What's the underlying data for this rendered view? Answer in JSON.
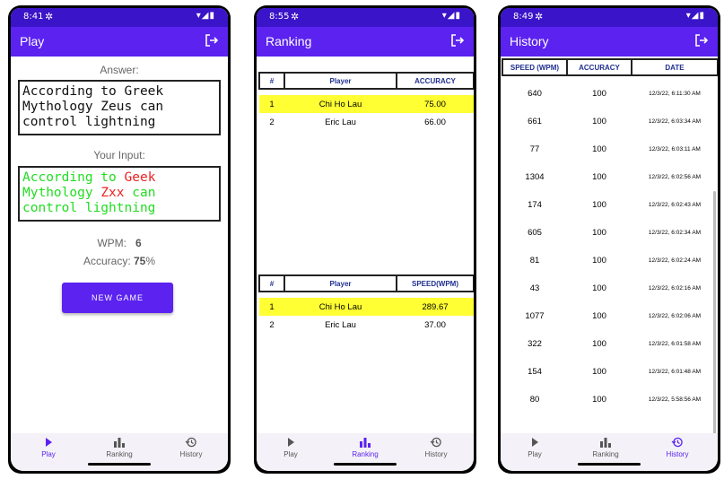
{
  "nav": {
    "play": "Play",
    "ranking": "Ranking",
    "history": "History"
  },
  "play_screen": {
    "status_time": "8:41",
    "title": "Play",
    "answer_label": "Answer:",
    "answer_text": "According to Greek Mythology Zeus can control lightning",
    "input_label": "Your Input:",
    "input_segments": [
      {
        "text": "According to ",
        "correct": true
      },
      {
        "text": "Geek",
        "correct": false
      },
      {
        "text": " Mythology ",
        "correct": true
      },
      {
        "text": "Zxx",
        "correct": false
      },
      {
        "text": " can control lightning",
        "correct": true
      }
    ],
    "wpm_label": "WPM:",
    "wpm_value": "6",
    "accuracy_label": "Accuracy:",
    "accuracy_value": "75",
    "accuracy_unit": "%",
    "new_game": "NEW GAME"
  },
  "ranking_screen": {
    "status_time": "8:55",
    "title": "Ranking",
    "accuracy_table": {
      "headers": [
        "#",
        "Player",
        "ACCURACY"
      ],
      "rows": [
        {
          "rank": "1",
          "player": "Chi Ho Lau",
          "value": "75.00",
          "highlight": true
        },
        {
          "rank": "2",
          "player": "Eric Lau",
          "value": "66.00",
          "highlight": false
        }
      ]
    },
    "speed_table": {
      "headers": [
        "#",
        "Player",
        "SPEED(WPM)"
      ],
      "rows": [
        {
          "rank": "1",
          "player": "Chi Ho Lau",
          "value": "289.67",
          "highlight": true
        },
        {
          "rank": "2",
          "player": "Eric Lau",
          "value": "37.00",
          "highlight": false
        }
      ]
    }
  },
  "history_screen": {
    "status_time": "8:49",
    "title": "History",
    "headers": [
      "SPEED (WPM)",
      "ACCURACY",
      "DATE"
    ],
    "rows": [
      {
        "speed": "640",
        "accuracy": "100",
        "date": "12/3/22, 6:11:30 AM"
      },
      {
        "speed": "661",
        "accuracy": "100",
        "date": "12/3/22, 6:03:34 AM"
      },
      {
        "speed": "77",
        "accuracy": "100",
        "date": "12/3/22, 6:03:11 AM"
      },
      {
        "speed": "1304",
        "accuracy": "100",
        "date": "12/3/22, 6:02:56 AM"
      },
      {
        "speed": "174",
        "accuracy": "100",
        "date": "12/3/22, 6:02:43 AM"
      },
      {
        "speed": "605",
        "accuracy": "100",
        "date": "12/3/22, 6:02:34 AM"
      },
      {
        "speed": "81",
        "accuracy": "100",
        "date": "12/3/22, 6:02:24 AM"
      },
      {
        "speed": "43",
        "accuracy": "100",
        "date": "12/3/22, 6:02:16 AM"
      },
      {
        "speed": "1077",
        "accuracy": "100",
        "date": "12/3/22, 6:02:06 AM"
      },
      {
        "speed": "322",
        "accuracy": "100",
        "date": "12/3/22, 6:01:58 AM"
      },
      {
        "speed": "154",
        "accuracy": "100",
        "date": "12/3/22, 6:01:48 AM"
      },
      {
        "speed": "80",
        "accuracy": "100",
        "date": "12/3/22, 5:58:56 AM"
      }
    ]
  },
  "colors": {
    "primary": "#5b22f0",
    "status_bar": "#3a14c8",
    "highlight": "#ffff33",
    "correct": "#22dd22",
    "incorrect": "#ee2222",
    "header_text": "#1f2f8f"
  },
  "icons": {
    "settings": "gear-icon",
    "exit": "exit-to-app-icon",
    "play": "play-arrow-icon",
    "ranking": "bar-chart-icon",
    "history": "history-icon"
  }
}
